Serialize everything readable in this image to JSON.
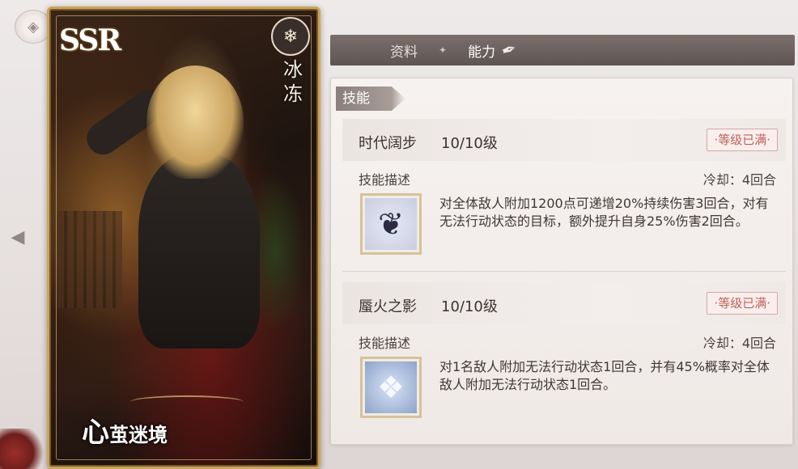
{
  "nav": {
    "back_icon": "back-diamond-icon",
    "side_icon": "side-arrow-icon"
  },
  "card": {
    "rarity": "SSR",
    "attribute_icon": "snowflake-icon",
    "attribute": "冰冻",
    "name_first": "心",
    "name_rest": "茧迷境"
  },
  "tabs": [
    {
      "label": "资料",
      "active": false
    },
    {
      "label": "能力",
      "active": true
    }
  ],
  "section": {
    "title": "技能"
  },
  "skills": [
    {
      "name": "时代阔步",
      "level": "10/10级",
      "max_badge": "·等级已满·",
      "desc_label": "技能描述",
      "cooldown": "冷却：4回合",
      "icon": "thorn-orb-icon",
      "description": "对全体敌人附加1200点可递增20%持续伤害3回合，对有无法行动状态的目标，额外提升自身25%伤害2回合。"
    },
    {
      "name": "蜃火之影",
      "level": "10/10级",
      "max_badge": "·等级已满·",
      "desc_label": "技能描述",
      "cooldown": "冷却：4回合",
      "icon": "ice-crystal-icon",
      "description": "对1名敌人附加无法行动状态1回合，并有45%概率对全体敌人附加无法行动状态1回合。"
    }
  ],
  "colors": {
    "accent_gold": "#caa55d",
    "badge_red": "#c0625a",
    "tab_bg": "#6b605d"
  }
}
